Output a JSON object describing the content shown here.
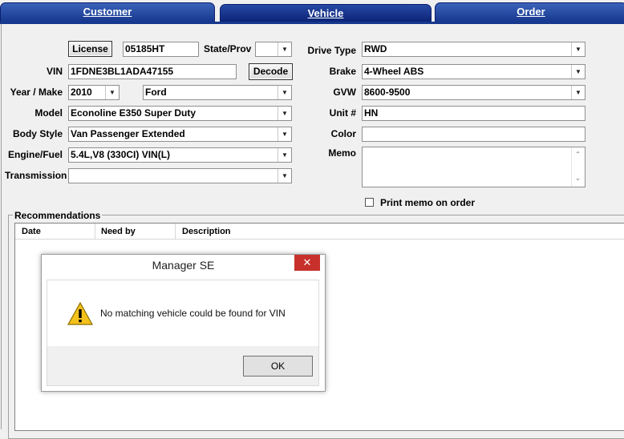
{
  "tabs": [
    {
      "label": "Customer",
      "active": false
    },
    {
      "label": "Vehicle",
      "active": true
    },
    {
      "label": "Order",
      "active": false
    }
  ],
  "vehicle": {
    "license_button": "License",
    "license_value": "05185HT",
    "state_label": "State/Prov",
    "state_value": "",
    "vin_label": "VIN",
    "vin_value": "1FDNE3BL1ADA47155",
    "decode_button": "Decode",
    "year_make_label": "Year / Make",
    "year_value": "2010",
    "make_value": "Ford",
    "model_label": "Model",
    "model_value": "Econoline E350 Super Duty",
    "body_label": "Body Style",
    "body_value": "Van Passenger Extended",
    "engine_label": "Engine/Fuel",
    "engine_value": "5.4L,V8 (330CI) VIN(L)",
    "transmission_label": "Transmission",
    "transmission_value": "",
    "drive_label": "Drive Type",
    "drive_value": "RWD",
    "brake_label": "Brake",
    "brake_value": "4-Wheel ABS",
    "gvw_label": "GVW",
    "gvw_value": "8600-9500",
    "unit_label": "Unit #",
    "unit_value": "HN",
    "color_label": "Color",
    "color_value": "",
    "memo_label": "Memo",
    "memo_value": "",
    "print_memo_label": "Print memo on order",
    "print_memo_checked": false
  },
  "recommendations": {
    "title": "Recommendations",
    "columns": [
      "Date",
      "Need by",
      "Description"
    ]
  },
  "dialog": {
    "title": "Manager SE",
    "message": "No matching vehicle could be found for VIN",
    "ok_button": "OK",
    "icon": "warning-icon",
    "close_icon": "close-icon"
  },
  "colors": {
    "tab_blue": "#17388f",
    "close_red": "#c7302b",
    "warning_yellow": "#f4c21c"
  }
}
